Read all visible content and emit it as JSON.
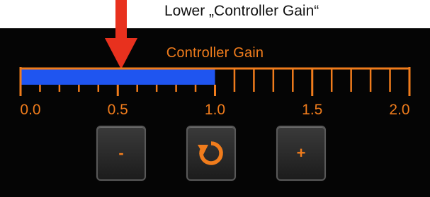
{
  "annotation": {
    "text": "Lower „Controller Gain“",
    "color": "#e8311e"
  },
  "gauge": {
    "title": "Controller Gain",
    "min": 0.0,
    "max": 2.0,
    "value": 1.0,
    "tick_labels": [
      "0.0",
      "0.5",
      "1.0",
      "1.5",
      "2.0"
    ],
    "fill_color": "#1f55f0",
    "accent_color": "#f07c1c"
  },
  "buttons": {
    "decrease_label": "-",
    "reset_icon": "reset-icon",
    "increase_label": "+"
  }
}
